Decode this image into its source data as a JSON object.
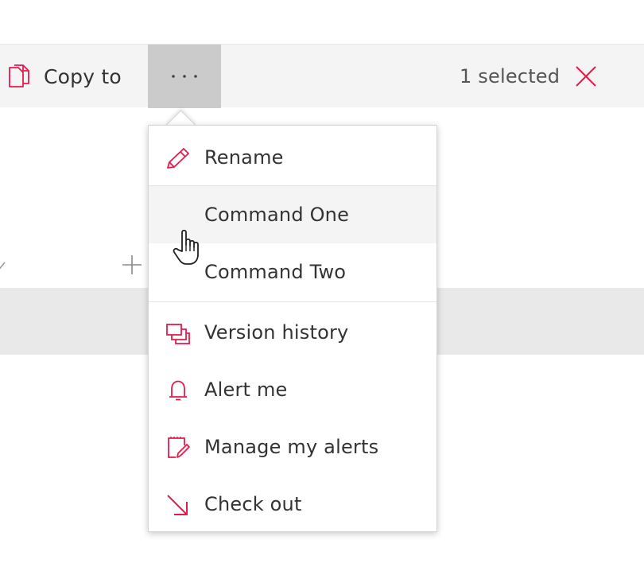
{
  "toolbar": {
    "copy_to_label": "Copy to",
    "copy_to_icon": "copy-icon",
    "more_icon": "ellipsis-icon",
    "selected_text": "1 selected",
    "clear_icon": "close-icon"
  },
  "menu": {
    "items": [
      {
        "label": "Rename",
        "icon": "pencil-icon"
      },
      {
        "label": "Command One",
        "icon": ""
      },
      {
        "label": "Command Two",
        "icon": ""
      },
      {
        "label": "Version history",
        "icon": "version-history-icon"
      },
      {
        "label": "Alert me",
        "icon": "bell-icon"
      },
      {
        "label": "Manage my alerts",
        "icon": "manage-alerts-icon"
      },
      {
        "label": "Check out",
        "icon": "check-out-arrow-icon"
      }
    ],
    "hovered_item": "Command One"
  },
  "colors": {
    "accent": "#e8194a",
    "commandbar_bg": "#f4f4f4",
    "more_button_active_bg": "#cbcbcb",
    "menu_hover_bg": "#f4f4f4",
    "row_bg": "#e9e9e9"
  }
}
